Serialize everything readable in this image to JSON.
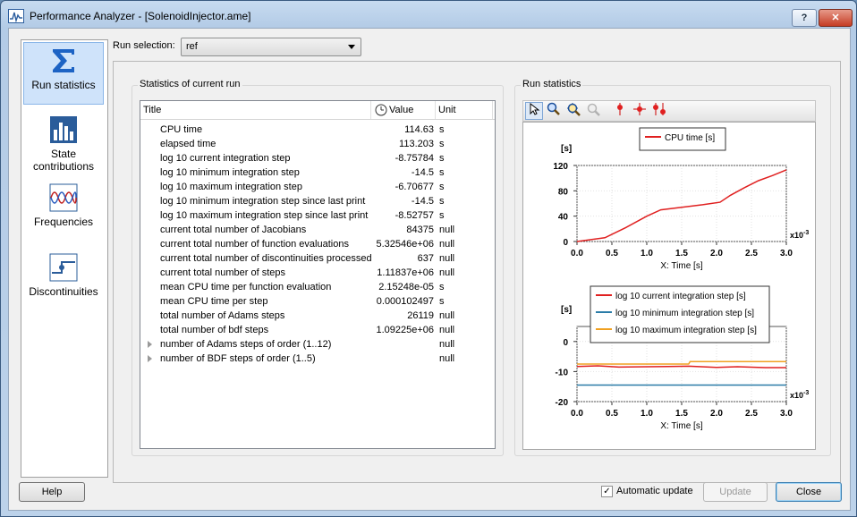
{
  "window": {
    "title": "Performance Analyzer - [SolenoidInjector.ame]",
    "help_button": "?",
    "close_button": "✕"
  },
  "nav": {
    "items": [
      {
        "label": "Run statistics",
        "icon": "sigma-icon",
        "active": true
      },
      {
        "label": "State contributions",
        "icon": "bar-chart-icon",
        "active": false
      },
      {
        "label": "Frequencies",
        "icon": "wave-icon",
        "active": false
      },
      {
        "label": "Discontinuities",
        "icon": "step-icon",
        "active": false
      }
    ]
  },
  "run_selection": {
    "label": "Run selection:",
    "value": "ref"
  },
  "stats_group": {
    "title": "Statistics of current run",
    "columns": {
      "title": "Title",
      "value": "Value",
      "unit": "Unit"
    },
    "rows": [
      {
        "title": "CPU time",
        "value": "114.63",
        "unit": "s"
      },
      {
        "title": "elapsed time",
        "value": "113.203",
        "unit": "s"
      },
      {
        "title": "log 10 current integration step",
        "value": "-8.75784",
        "unit": "s"
      },
      {
        "title": "log 10 minimum integration step",
        "value": "-14.5",
        "unit": "s"
      },
      {
        "title": "log 10 maximum integration step",
        "value": "-6.70677",
        "unit": "s"
      },
      {
        "title": "log 10 minimum integration step since last print",
        "value": "-14.5",
        "unit": "s"
      },
      {
        "title": "log 10 maximum integration step since last print",
        "value": "-8.52757",
        "unit": "s"
      },
      {
        "title": "current total number of Jacobians",
        "value": "84375",
        "unit": "null"
      },
      {
        "title": "current total number of function evaluations",
        "value": "5.32546e+06",
        "unit": "null"
      },
      {
        "title": "current total number of discontinuities processed",
        "value": "637",
        "unit": "null"
      },
      {
        "title": "current total number of steps",
        "value": "1.11837e+06",
        "unit": "null"
      },
      {
        "title": "mean CPU time per function evaluation",
        "value": "2.15248e-05",
        "unit": "s"
      },
      {
        "title": "mean CPU time per step",
        "value": "0.000102497",
        "unit": "s"
      },
      {
        "title": "total number of Adams steps",
        "value": "26119",
        "unit": "null"
      },
      {
        "title": "total number of bdf steps",
        "value": "1.09225e+06",
        "unit": "null"
      },
      {
        "title": "number of Adams steps of order (1..12)",
        "value": "",
        "unit": "null",
        "expandable": true
      },
      {
        "title": "number of BDF steps of order (1..5)",
        "value": "",
        "unit": "null",
        "expandable": true
      }
    ]
  },
  "chart_group": {
    "title": "Run statistics"
  },
  "chart_data": [
    {
      "type": "line",
      "ylabel": "[s]",
      "xlabel": "X: Time [s]",
      "x_multiplier": "x10-3",
      "xlim": [
        0,
        3.0
      ],
      "ylim": [
        0,
        120
      ],
      "xticks": [
        "0.0",
        "0.5",
        "1.0",
        "1.5",
        "2.0",
        "2.5",
        "3.0"
      ],
      "yticks": [
        "0",
        "40",
        "80",
        "120"
      ],
      "legend_position": "top",
      "series": [
        {
          "name": "CPU time [s]",
          "color": "#e02020",
          "x": [
            0,
            0.2,
            0.4,
            0.7,
            1.0,
            1.2,
            1.5,
            1.8,
            2.05,
            2.2,
            2.4,
            2.6,
            2.8,
            3.0
          ],
          "y": [
            0,
            3,
            6,
            22,
            40,
            50,
            54,
            58,
            62,
            73,
            85,
            96,
            104,
            113
          ]
        }
      ]
    },
    {
      "type": "line",
      "ylabel": "[s]",
      "xlabel": "X: Time [s]",
      "x_multiplier": "x10-3",
      "xlim": [
        0,
        3.0
      ],
      "ylim": [
        -20,
        5
      ],
      "xticks": [
        "0.0",
        "0.5",
        "1.0",
        "1.5",
        "2.0",
        "2.5",
        "3.0"
      ],
      "yticks": [
        "-20",
        "-10",
        "0"
      ],
      "legend_position": "top",
      "series": [
        {
          "name": "log 10 current integration step [s]",
          "color": "#e02020",
          "x": [
            0,
            0.3,
            0.6,
            1.0,
            1.3,
            1.6,
            2.0,
            2.3,
            2.7,
            3.0
          ],
          "y": [
            -8.3,
            -8.1,
            -8.5,
            -8.4,
            -8.3,
            -8.2,
            -8.6,
            -8.4,
            -8.7,
            -8.7
          ]
        },
        {
          "name": "log 10 minimum integration step [s]",
          "color": "#2a7ca8",
          "x": [
            0,
            3.0
          ],
          "y": [
            -14.5,
            -14.5
          ]
        },
        {
          "name": "log 10 maximum integration step [s]",
          "color": "#f0a020",
          "x": [
            0,
            1.6,
            1.62,
            3.0
          ],
          "y": [
            -7.5,
            -7.5,
            -6.7,
            -6.7
          ]
        }
      ]
    }
  ],
  "footer": {
    "help": "Help",
    "auto_update_label": "Automatic update",
    "auto_update_checked": true,
    "update": "Update",
    "close": "Close"
  }
}
